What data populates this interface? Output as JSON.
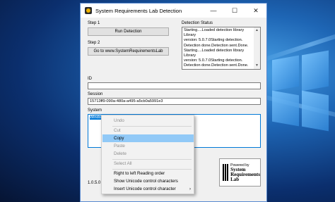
{
  "window": {
    "title": "System Requirements Lab Detection",
    "minimize_glyph": "—",
    "maximize_glyph": "☐",
    "close_glyph": "✕"
  },
  "step1": {
    "label": "Step 1",
    "button": "Run Detection"
  },
  "step2": {
    "label": "Step 2",
    "button": "Go to www.SystemRequirementsLab"
  },
  "detection_status": {
    "label": "Detection Status",
    "lines": [
      "Starting....Loaded detection library Library",
      "version: 5.0.7.0Starting detection.",
      "Detection done.Detection sent.Done.",
      "Starting....Loaded detection library Library",
      "version: 5.0.7.0Starting detection.",
      "Detection done.Detection sent.Done."
    ]
  },
  "id_field": {
    "label": "ID",
    "value": ""
  },
  "session_field": {
    "label": "Session",
    "value": "15713ff9-090a-480a-a495-a5cb0a5991e3"
  },
  "system_field": {
    "label": "System",
    "value": "Windo"
  },
  "version": "1.0.5.0",
  "logo": {
    "powered_by": "Powered by",
    "line1": "System",
    "line2": "Requirements",
    "line3": "Lab"
  },
  "context_menu": {
    "items": [
      {
        "label": "Undo",
        "disabled": true
      },
      {
        "label": "Cut",
        "disabled": true
      },
      {
        "label": "Copy",
        "disabled": false,
        "highlighted": true
      },
      {
        "label": "Paste",
        "disabled": true
      },
      {
        "label": "Delete",
        "disabled": true
      },
      {
        "label": "Select All",
        "disabled": true
      },
      {
        "label": "Right to left Reading order",
        "disabled": false
      },
      {
        "label": "Show Unicode control characters",
        "disabled": false
      },
      {
        "label": "Insert Unicode control character",
        "disabled": false,
        "submenu": true
      }
    ],
    "submenu_arrow": "›"
  },
  "colors": {
    "selection": "#0078d7",
    "highlight": "#91c9f7",
    "window_border": "#5a8ad0"
  }
}
